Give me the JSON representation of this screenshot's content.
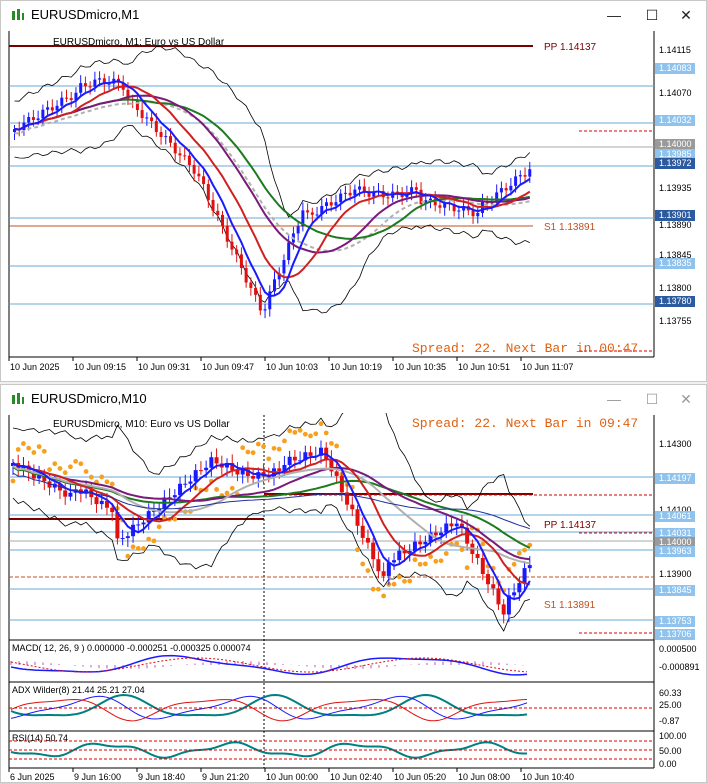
{
  "top": {
    "title": "EURUSDmicro,M1",
    "header": "EURUSDmicro, M1:  Euro vs US Dollar",
    "pp_label": "PP 1.14137",
    "s1_label": "S1 1.13891",
    "spread": "Spread: 22. Next Bar in 00:47",
    "price_labels": [
      {
        "text": "1.14115",
        "hl": false
      },
      {
        "text": "1.14083",
        "hl": true
      },
      {
        "text": "1.14070",
        "hl": false
      },
      {
        "text": "1.14032",
        "hl": true
      },
      {
        "text": "1.14000",
        "hl": "gray"
      },
      {
        "text": "1.13985",
        "hl": true
      },
      {
        "text": "1.13972",
        "hl": "dark"
      },
      {
        "text": "1.13935",
        "hl": false
      },
      {
        "text": "1.13901",
        "hl": "dark"
      },
      {
        "text": "1.13890",
        "hl": false
      },
      {
        "text": "1.13845",
        "hl": false
      },
      {
        "text": "1.13835",
        "hl": true
      },
      {
        "text": "1.13800",
        "hl": false
      },
      {
        "text": "1.13780",
        "hl": "dark"
      },
      {
        "text": "1.13755",
        "hl": false
      }
    ],
    "time_labels": [
      "10 Jun 2025",
      "10 Jun 09:15",
      "10 Jun 09:31",
      "10 Jun 09:47",
      "10 Jun 10:03",
      "10 Jun 10:19",
      "10 Jun 10:35",
      "10 Jun 10:51",
      "10 Jun 11:07"
    ]
  },
  "bottom": {
    "title": "EURUSDmicro,M10",
    "header": "EURUSDmicro, M10:  Euro vs US Dollar",
    "pp_label": "PP 1.14137",
    "s1_label": "S1 1.13891",
    "spread": "Spread: 22. Next Bar in 09:47",
    "price_labels": [
      {
        "text": "1.14300",
        "hl": false
      },
      {
        "text": "1.14197",
        "hl": true
      },
      {
        "text": "1.14100",
        "hl": false
      },
      {
        "text": "1.14061",
        "hl": true
      },
      {
        "text": "1.14031",
        "hl": true
      },
      {
        "text": "1.14000",
        "hl": "gray"
      },
      {
        "text": "1.13963",
        "hl": true
      },
      {
        "text": "1.13900",
        "hl": false
      },
      {
        "text": "1.13845",
        "hl": true
      },
      {
        "text": "1.13753",
        "hl": true
      },
      {
        "text": "1.13706",
        "hl": true
      }
    ],
    "macd_label": "MACD( 12, 26, 9 ) 0.000000 -0.000251 -0.000325 0.000074",
    "macd_scale": [
      "0.000500",
      "-0.000891"
    ],
    "adx_label": "ADX Wilder(8) 21.44 25.21 27.04",
    "adx_scale": [
      "60.33",
      "25.00",
      "-0.87"
    ],
    "rsi_label": "RSI(14) 50.74",
    "rsi_scale": [
      "100.00",
      "50.00",
      "0.00"
    ],
    "time_labels": [
      "6 Jun 2025",
      "9 Jun 16:00",
      "9 Jun 18:40",
      "9 Jun 21:20",
      "10 Jun 00:00",
      "10 Jun 02:40",
      "10 Jun 05:20",
      "10 Jun 08:00",
      "10 Jun 10:40"
    ]
  },
  "controls": {
    "minimize": "—",
    "maximize": "☐",
    "close": "✕"
  },
  "colors": {
    "bull": "#1a1aff",
    "bear": "#e01010",
    "pp": "#7a0000",
    "s1": "#c05020",
    "hline": "#6aa9d8",
    "spread": "#e06010",
    "psar": "#f7a01e",
    "ema_green": "#1e7a1e",
    "ema_purple": "#7a1a7a",
    "ema_gray": "#b0b0b0"
  }
}
